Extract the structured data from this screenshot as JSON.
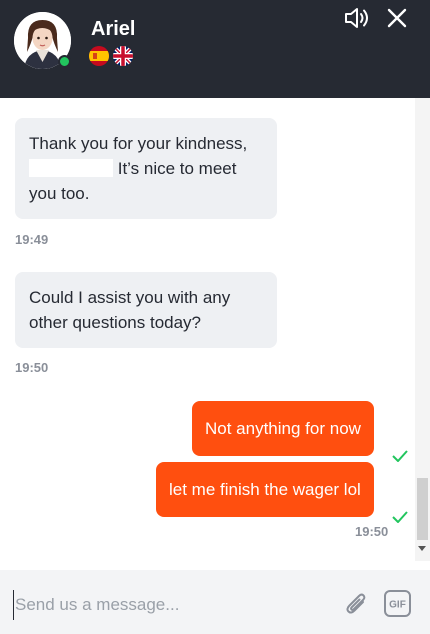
{
  "agent": {
    "name": "Ariel",
    "status": "online"
  },
  "header": {
    "languages": [
      "Spanish",
      "English"
    ]
  },
  "messages": [
    {
      "from": "agent",
      "line1": "Thank you for your kindness,",
      "line2_suffix": " It’s nice to meet",
      "line3": "you too.",
      "time": "19:49"
    },
    {
      "from": "agent",
      "line1": "Could I assist you with any",
      "line2": "other questions today?",
      "time": "19:50"
    },
    {
      "from": "user",
      "text": "Not anything for now"
    },
    {
      "from": "user",
      "text": "let me finish the wager lol",
      "time": "19:50"
    }
  ],
  "composer": {
    "placeholder": "Send us a message..."
  },
  "icons": {
    "sound": "speaker-icon",
    "close": "close-icon",
    "attach": "paperclip-icon",
    "gif": "gif-icon",
    "read": "checkmark-icon"
  },
  "colors": {
    "header": "#262a33",
    "accent": "#ff4f0f",
    "incoming_bubble": "#eef0f3",
    "online": "#22c55e",
    "read_check": "#22c55e"
  }
}
